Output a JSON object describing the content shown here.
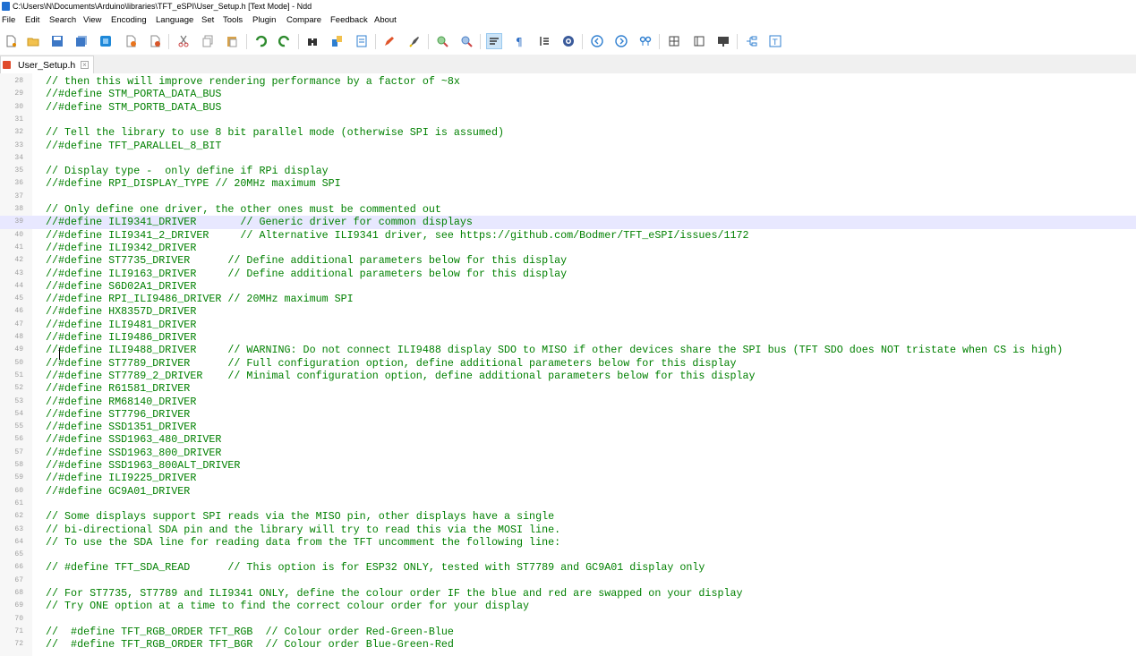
{
  "window": {
    "title": "C:\\Users\\N\\Documents\\Arduino\\libraries\\TFT_eSPI\\User_Setup.h [Text Mode] - Ndd"
  },
  "menu": [
    "File",
    "Edit",
    "Search",
    "View",
    "Encoding",
    "Language",
    "Set",
    "Tools",
    "Plugin",
    "Compare",
    "Feedback",
    "About"
  ],
  "toolbar": {
    "buttons": [
      "new-file-icon",
      "open-folder-icon",
      "save-icon",
      "save-all-icon",
      "close-icon",
      "close-all-icon",
      "close-others-icon",
      "cut-icon",
      "copy-icon",
      "paste-icon",
      "undo-icon",
      "redo-icon",
      "find-icon",
      "replace-icon",
      "goto-icon",
      "pencil-icon",
      "highlight-icon",
      "zoom-in-icon",
      "zoom-out-icon",
      "word-wrap-icon",
      "show-symbols-icon",
      "indent-guide-icon",
      "target-icon",
      "back-icon",
      "forward-icon",
      "compare-icon",
      "column-icon",
      "panel-icon",
      "monitor-icon",
      "tree-icon",
      "text-mode-icon"
    ]
  },
  "tab": {
    "label": "User_Setup.h",
    "close": "×"
  },
  "editor": {
    "lines": [
      {
        "n": "28",
        "text": "// then this will improve rendering performance by a factor of ~8x"
      },
      {
        "n": "29",
        "text": "//#define STM_PORTA_DATA_BUS"
      },
      {
        "n": "30",
        "text": "//#define STM_PORTB_DATA_BUS"
      },
      {
        "n": "31",
        "text": ""
      },
      {
        "n": "32",
        "text": "// Tell the library to use 8 bit parallel mode (otherwise SPI is assumed)"
      },
      {
        "n": "33",
        "text": "//#define TFT_PARALLEL_8_BIT"
      },
      {
        "n": "34",
        "text": ""
      },
      {
        "n": "35",
        "text": "// Display type -  only define if RPi display"
      },
      {
        "n": "36",
        "text": "//#define RPI_DISPLAY_TYPE // 20MHz maximum SPI"
      },
      {
        "n": "37",
        "text": ""
      },
      {
        "n": "38",
        "text": "// Only define one driver, the other ones must be commented out"
      },
      {
        "n": "39",
        "text": "//#define ILI9341_DRIVER       // Generic driver for common displays"
      },
      {
        "n": "40",
        "text": "//#define ILI9341_2_DRIVER     // Alternative ILI9341 driver, see https://github.com/Bodmer/TFT_eSPI/issues/1172"
      },
      {
        "n": "41",
        "text": "//#define ILI9342_DRIVER"
      },
      {
        "n": "42",
        "text": "//#define ST7735_DRIVER      // Define additional parameters below for this display"
      },
      {
        "n": "43",
        "text": "//#define ILI9163_DRIVER     // Define additional parameters below for this display"
      },
      {
        "n": "44",
        "text": "//#define S6D02A1_DRIVER"
      },
      {
        "n": "45",
        "text": "//#define RPI_ILI9486_DRIVER // 20MHz maximum SPI"
      },
      {
        "n": "46",
        "text": "//#define HX8357D_DRIVER"
      },
      {
        "n": "47",
        "text": "//#define ILI9481_DRIVER"
      },
      {
        "n": "48",
        "text": "//#define ILI9486_DRIVER"
      },
      {
        "n": "49",
        "text": "//#define ILI9488_DRIVER     // WARNING: Do not connect ILI9488 display SDO to MISO if other devices share the SPI bus (TFT SDO does NOT tristate when CS is high)"
      },
      {
        "n": "50",
        "text": "//#define ST7789_DRIVER      // Full configuration option, define additional parameters below for this display"
      },
      {
        "n": "51",
        "text": "//#define ST7789_2_DRIVER    // Minimal configuration option, define additional parameters below for this display"
      },
      {
        "n": "52",
        "text": "//#define R61581_DRIVER"
      },
      {
        "n": "53",
        "text": "//#define RM68140_DRIVER"
      },
      {
        "n": "54",
        "text": "//#define ST7796_DRIVER"
      },
      {
        "n": "55",
        "text": "//#define SSD1351_DRIVER"
      },
      {
        "n": "56",
        "text": "//#define SSD1963_480_DRIVER"
      },
      {
        "n": "57",
        "text": "//#define SSD1963_800_DRIVER"
      },
      {
        "n": "58",
        "text": "//#define SSD1963_800ALT_DRIVER"
      },
      {
        "n": "59",
        "text": "//#define ILI9225_DRIVER"
      },
      {
        "n": "60",
        "text": "//#define GC9A01_DRIVER"
      },
      {
        "n": "61",
        "text": ""
      },
      {
        "n": "62",
        "text": "// Some displays support SPI reads via the MISO pin, other displays have a single"
      },
      {
        "n": "63",
        "text": "// bi-directional SDA pin and the library will try to read this via the MOSI line."
      },
      {
        "n": "64",
        "text": "// To use the SDA line for reading data from the TFT uncomment the following line:"
      },
      {
        "n": "65",
        "text": ""
      },
      {
        "n": "66",
        "text": "// #define TFT_SDA_READ      // This option is for ESP32 ONLY, tested with ST7789 and GC9A01 display only"
      },
      {
        "n": "67",
        "text": ""
      },
      {
        "n": "68",
        "text": "// For ST7735, ST7789 and ILI9341 ONLY, define the colour order IF the blue and red are swapped on your display"
      },
      {
        "n": "69",
        "text": "// Try ONE option at a time to find the correct colour order for your display"
      },
      {
        "n": "70",
        "text": ""
      },
      {
        "n": "71",
        "text": "//  #define TFT_RGB_ORDER TFT_RGB  // Colour order Red-Green-Blue"
      },
      {
        "n": "72",
        "text": "//  #define TFT_RGB_ORDER TFT_BGR  // Colour order Blue-Green-Red"
      }
    ],
    "current_line": "39",
    "colors": {
      "comment": "#008000",
      "line_number": "#a0a0a0",
      "current_line_bg": "#e8e8ff"
    }
  }
}
